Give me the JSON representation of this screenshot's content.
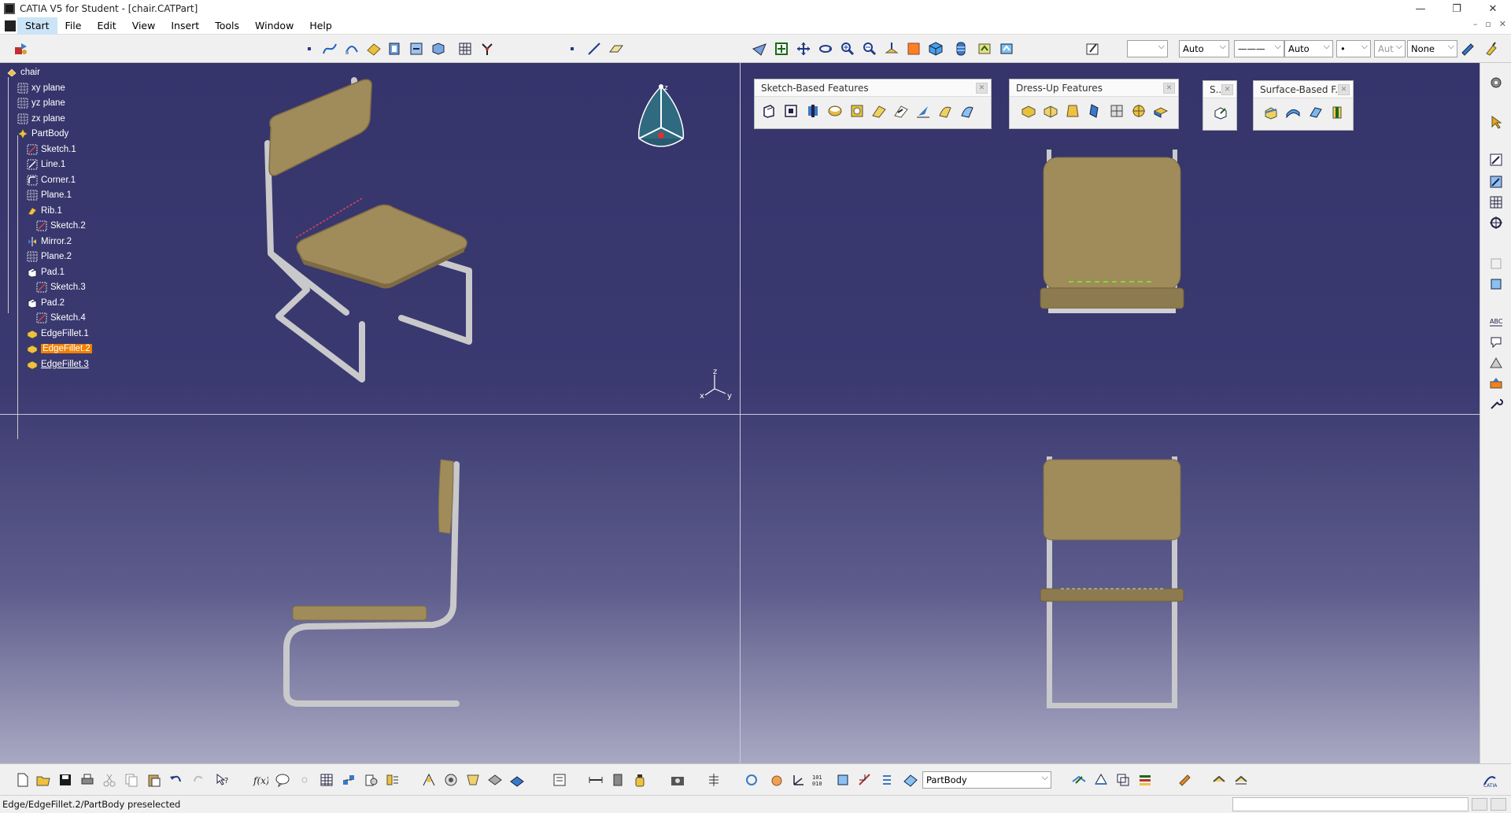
{
  "window": {
    "title": "CATIA V5 for Student - [chair.CATPart]",
    "controls": [
      "—",
      "❐",
      "✕"
    ]
  },
  "menu": {
    "items": [
      "Start",
      "File",
      "Edit",
      "View",
      "Insert",
      "Tools",
      "Window",
      "Help"
    ],
    "active": "Start",
    "mdi_controls": [
      "–",
      "▫",
      "✕"
    ]
  },
  "top_toolbar": {
    "line_weight_value": "",
    "linetype_auto": "Auto",
    "linestyle_value": "———",
    "thickness_auto": "Auto",
    "point_value": "•",
    "layer_auto": "Aut",
    "layer_none": "None"
  },
  "spec_tree": {
    "nodes": [
      {
        "label": "chair",
        "level": 0,
        "icon": "part-icon"
      },
      {
        "label": "xy plane",
        "level": 1,
        "icon": "plane-icon"
      },
      {
        "label": "yz plane",
        "level": 1,
        "icon": "plane-icon"
      },
      {
        "label": "zx plane",
        "level": 1,
        "icon": "plane-icon"
      },
      {
        "label": "PartBody",
        "level": 1,
        "icon": "body-icon"
      },
      {
        "label": "Sketch.1",
        "level": 2,
        "icon": "sketch-icon"
      },
      {
        "label": "Line.1",
        "level": 2,
        "icon": "line-icon"
      },
      {
        "label": "Corner.1",
        "level": 2,
        "icon": "corner-icon"
      },
      {
        "label": "Plane.1",
        "level": 2,
        "icon": "plane-icon"
      },
      {
        "label": "Rib.1",
        "level": 2,
        "icon": "rib-icon"
      },
      {
        "label": "Sketch.2",
        "level": 3,
        "icon": "sketch-icon"
      },
      {
        "label": "Mirror.2",
        "level": 2,
        "icon": "mirror-icon"
      },
      {
        "label": "Plane.2",
        "level": 2,
        "icon": "plane-icon"
      },
      {
        "label": "Pad.1",
        "level": 2,
        "icon": "pad-icon"
      },
      {
        "label": "Sketch.3",
        "level": 3,
        "icon": "sketch-icon"
      },
      {
        "label": "Pad.2",
        "level": 2,
        "icon": "pad-icon"
      },
      {
        "label": "Sketch.4",
        "level": 3,
        "icon": "sketch-icon"
      },
      {
        "label": "EdgeFillet.1",
        "level": 2,
        "icon": "fillet-icon"
      },
      {
        "label": "EdgeFillet.2",
        "level": 2,
        "icon": "fillet-icon",
        "state": "selected"
      },
      {
        "label": "EdgeFillet.3",
        "level": 2,
        "icon": "fillet-icon",
        "state": "preselected"
      }
    ]
  },
  "floating_toolbars": [
    {
      "title": "Sketch-Based Features",
      "tool_count": 10
    },
    {
      "title": "Dress-Up Features",
      "tool_count": 7
    },
    {
      "title": "S...",
      "tool_count": 1
    },
    {
      "title": "Surface-Based F...",
      "tool_count": 4
    }
  ],
  "compass": {
    "z_label": "z"
  },
  "axis_triad": {
    "x": "x",
    "y": "y",
    "z": "z"
  },
  "bottom_toolbar": {
    "current_body": "PartBody"
  },
  "status": {
    "text": "Edge/EdgeFillet.2/PartBody preselected"
  },
  "colors": {
    "viewport_top": "#35346b",
    "viewport_bottom": "#a9a8c2",
    "chair_wood": "#a08b5b",
    "chair_wood_dark": "#7e6b43",
    "chair_metal": "#c9c9cc",
    "selection": "#f08000"
  }
}
